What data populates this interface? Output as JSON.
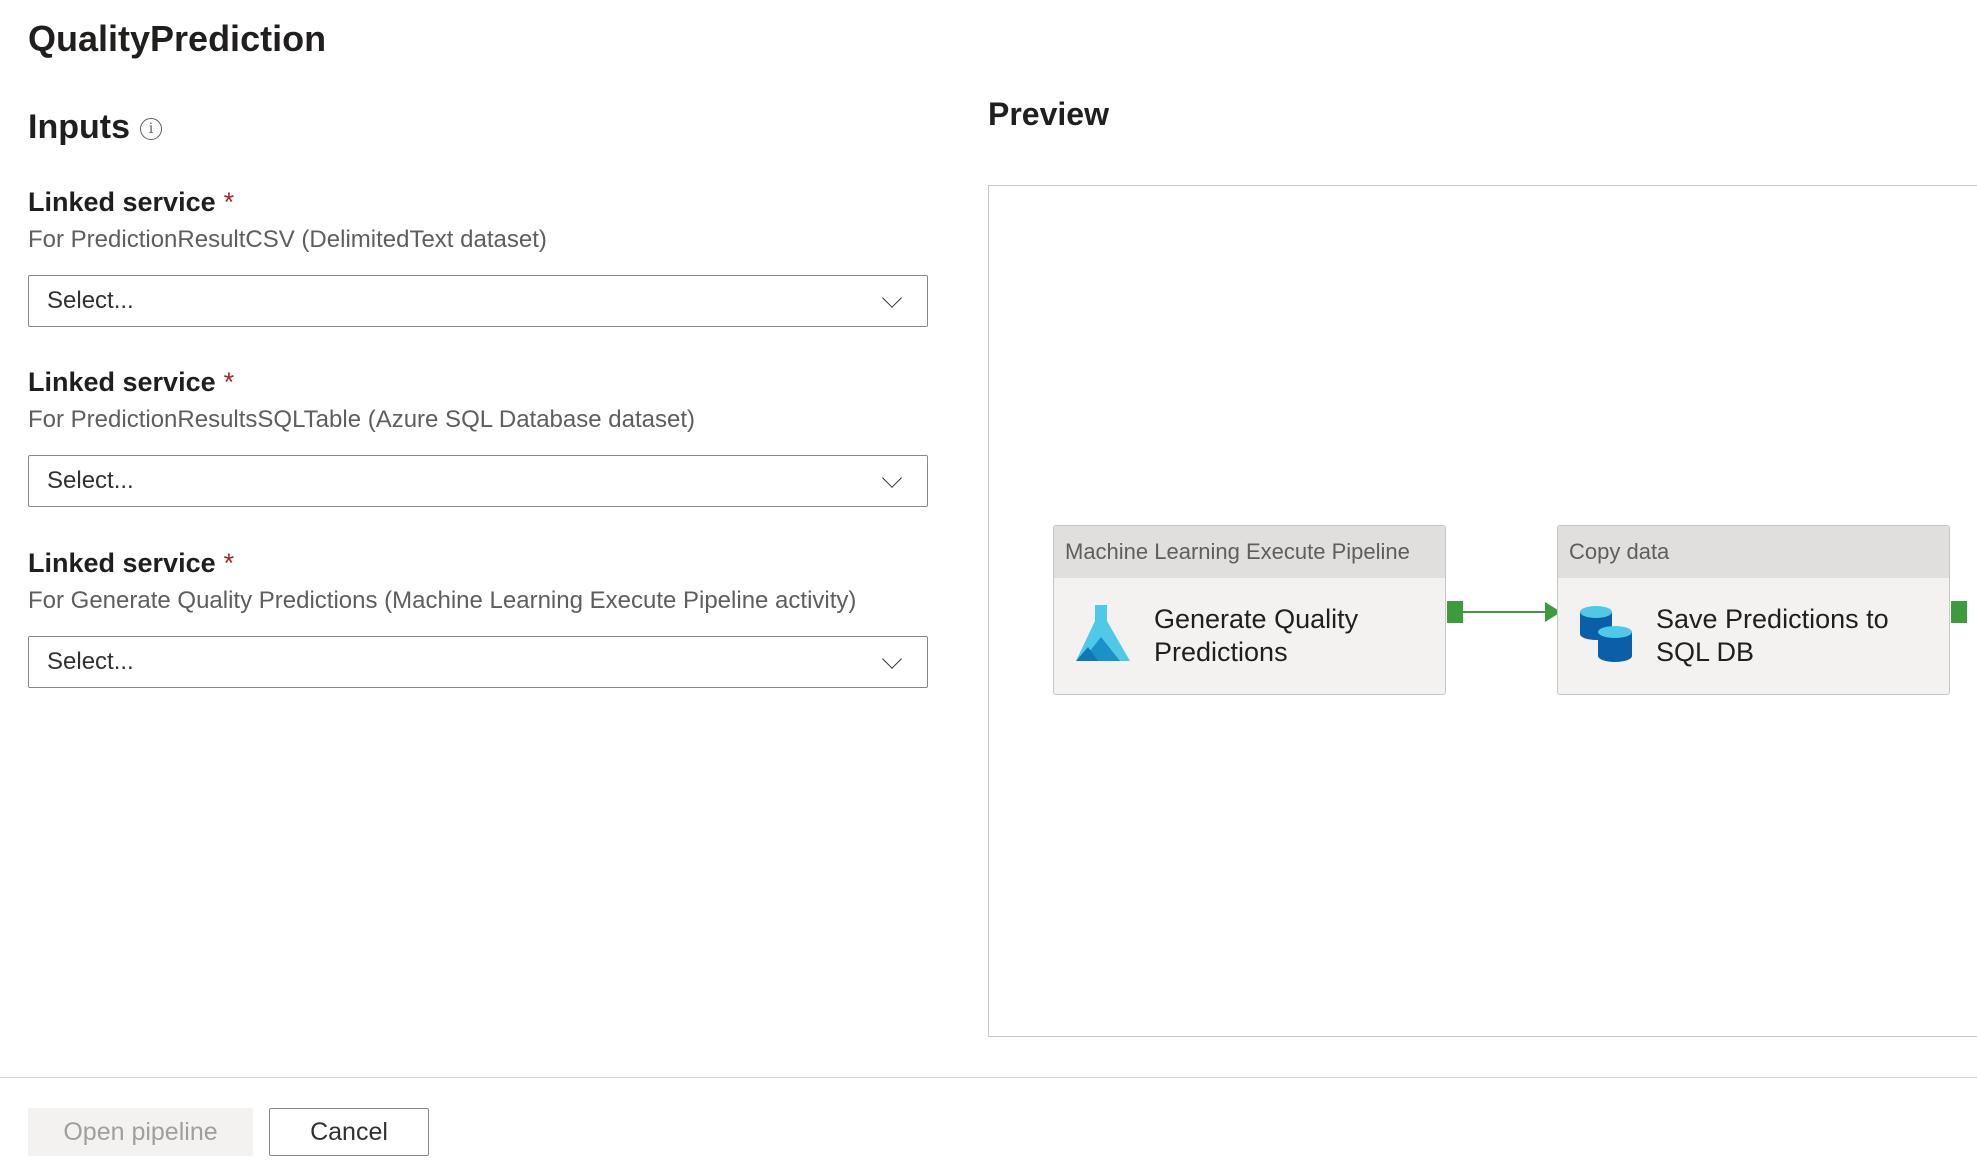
{
  "window": {
    "title": "QualityPrediction"
  },
  "inputs": {
    "heading": "Inputs",
    "info_icon": "info-icon",
    "fields": [
      {
        "label": "Linked service",
        "required_marker": "*",
        "description": "For PredictionResultCSV (DelimitedText dataset)",
        "placeholder": "Select..."
      },
      {
        "label": "Linked service",
        "required_marker": "*",
        "description": "For PredictionResultsSQLTable (Azure SQL Database dataset)",
        "placeholder": "Select..."
      },
      {
        "label": "Linked service",
        "required_marker": "*",
        "description": "For Generate Quality Predictions (Machine Learning Execute Pipeline activity)",
        "placeholder": "Select..."
      }
    ]
  },
  "preview": {
    "heading": "Preview",
    "activities": [
      {
        "type": "Machine Learning Execute Pipeline",
        "name_line1": "Generate Quality",
        "name_line2": "Predictions",
        "icon": "machine-learning-flask-icon"
      },
      {
        "type": "Copy data",
        "name_line1": "Save Predictions to",
        "name_line2": "SQL DB",
        "icon": "sql-database-icon"
      }
    ]
  },
  "footer": {
    "open_pipeline_label": "Open pipeline",
    "open_pipeline_enabled": false,
    "cancel_label": "Cancel"
  },
  "colors": {
    "required": "#a4262c",
    "connector": "#3c9c3c",
    "node_header": "#e1dfdd",
    "node_body": "#f3f2f1",
    "ml_icon": "#50c8e8",
    "sql_icon": "#0a5fa8"
  }
}
